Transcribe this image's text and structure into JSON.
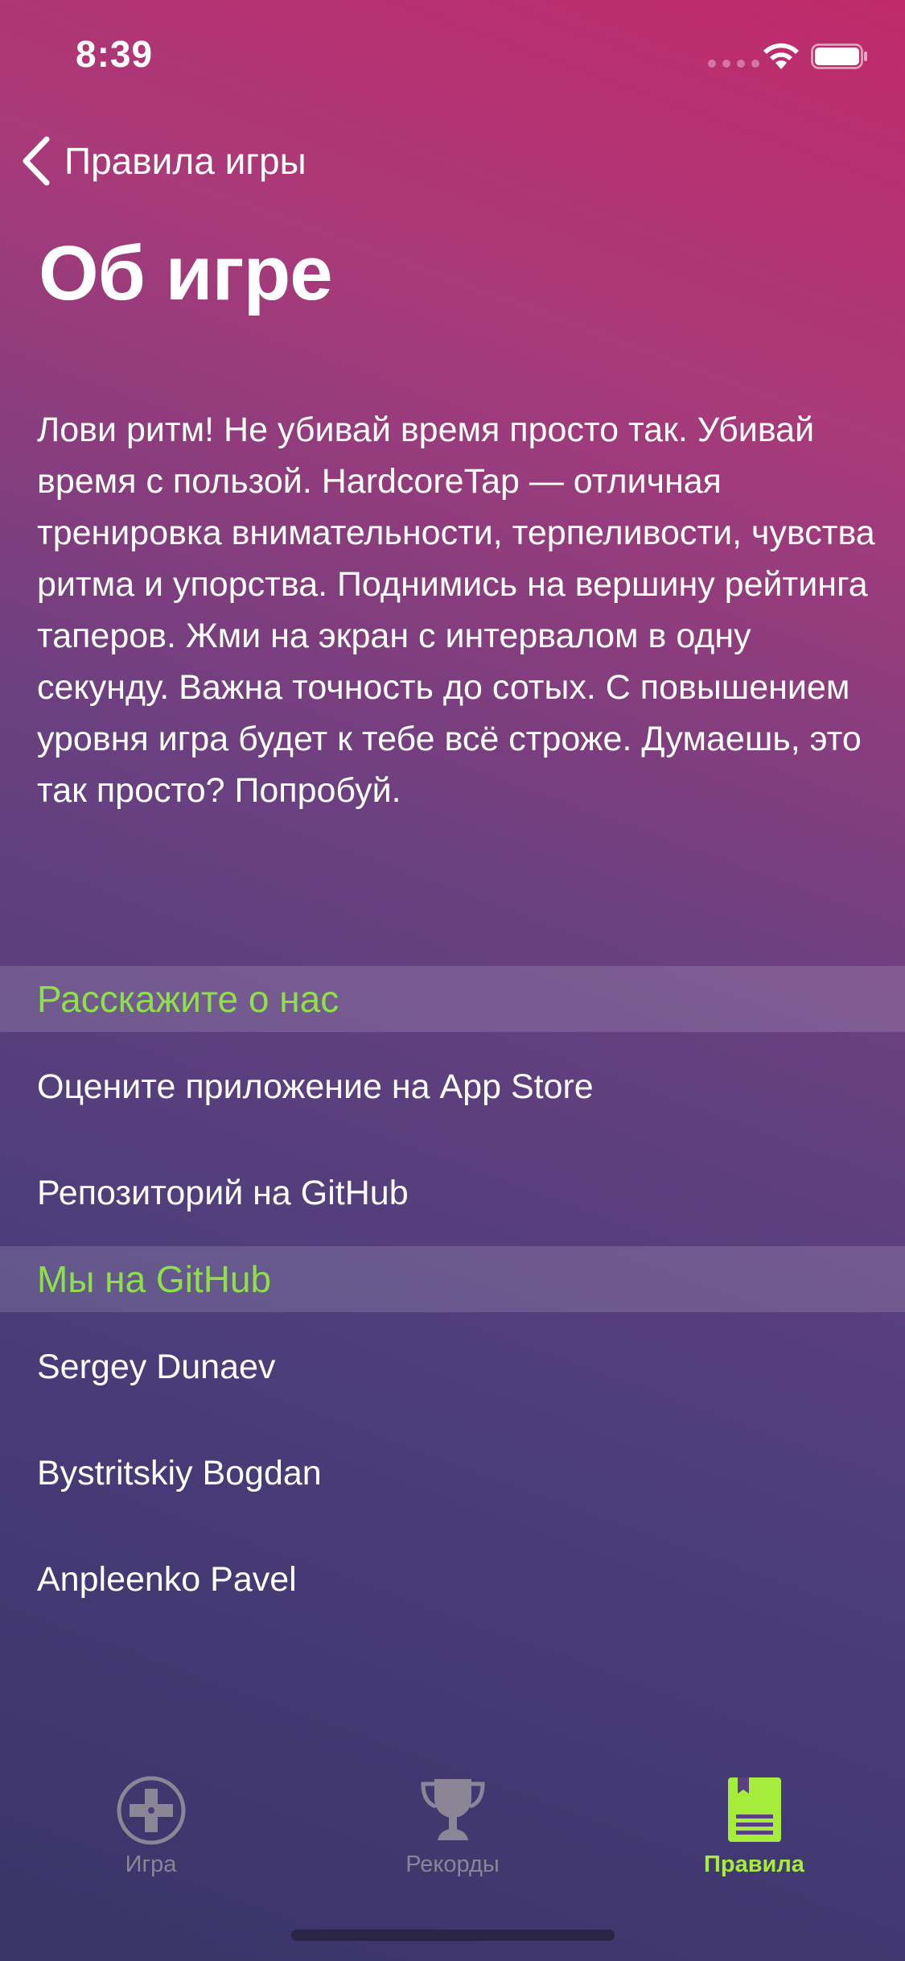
{
  "status_bar": {
    "time": "8:39"
  },
  "navigation": {
    "back_label": "Правила игры",
    "title": "Об игре"
  },
  "about": {
    "text": "Лови ритм! Не убивай время просто так. Убивай время с пользой. HardcoreTap — отличная тренировка внимательности, терпеливости, чувства ритма и упорства. Поднимись на вершину рейтинга таперов. Жми на экран с интервалом в одну секунду. Важна точность до сотых. С повышением уровня игра будет к тебе всё строже. Думаешь, это так просто? Попробуй."
  },
  "sections": [
    {
      "header": "Расскажите о нас",
      "items": [
        {
          "label": "Оцените приложение на App Store"
        },
        {
          "label": "Репозиторий на GitHub"
        }
      ]
    },
    {
      "header": "Мы на GitHub",
      "items": [
        {
          "label": "Sergey Dunaev"
        },
        {
          "label": "Bystritskiy Bogdan"
        },
        {
          "label": "Anpleenko Pavel"
        }
      ]
    }
  ],
  "tab_bar": {
    "tabs": [
      {
        "label": "Игра",
        "icon": "gamepad-icon",
        "active": false
      },
      {
        "label": "Рекорды",
        "icon": "trophy-icon",
        "active": false
      },
      {
        "label": "Правила",
        "icon": "book-icon",
        "active": true
      }
    ]
  },
  "colors": {
    "accent": "#8ee04a",
    "tab_active": "#a6ec3c",
    "tab_inactive": "#8a8696",
    "gradient_top": "#c02a6a",
    "gradient_bottom": "#3a3468"
  }
}
